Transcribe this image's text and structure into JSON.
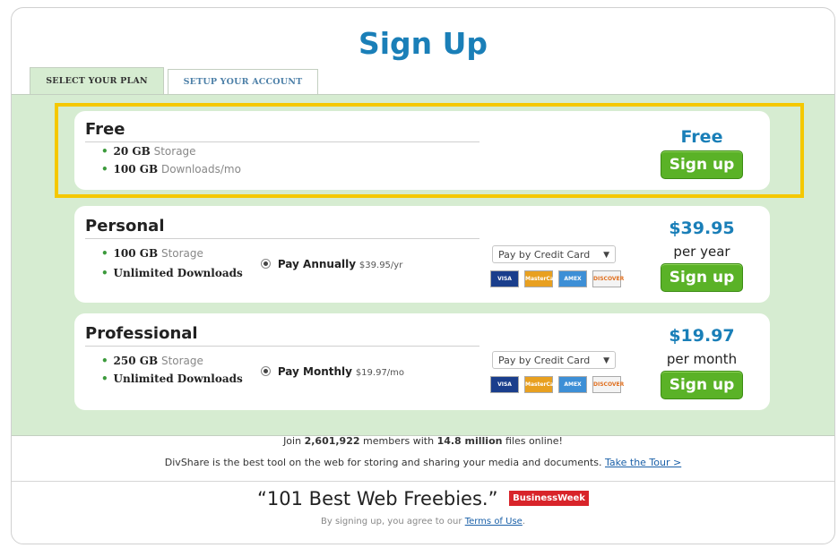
{
  "header": {
    "title": "Sign Up"
  },
  "tabs": [
    {
      "label": "SELECT YOUR PLAN",
      "active": true
    },
    {
      "label": "SETUP YOUR ACCOUNT",
      "active": false
    }
  ],
  "plans": {
    "free": {
      "name": "Free",
      "features": [
        {
          "bold": "20 GB",
          "light": "Storage"
        },
        {
          "bold": "100 GB",
          "light": "Downloads/mo"
        }
      ],
      "price": "Free",
      "button": "Sign up"
    },
    "personal": {
      "name": "Personal",
      "features": [
        {
          "bold": "100 GB",
          "light": "Storage"
        },
        {
          "bold": "Unlimited Downloads",
          "light": ""
        }
      ],
      "payment_option": {
        "label": "Pay Annually",
        "detail": "$39.95/yr"
      },
      "payment_select": "Pay by Credit Card",
      "price": "$39.95",
      "period": "per year",
      "button": "Sign up"
    },
    "professional": {
      "name": "Professional",
      "features": [
        {
          "bold": "250 GB",
          "light": "Storage"
        },
        {
          "bold": "Unlimited Downloads",
          "light": ""
        }
      ],
      "payment_option": {
        "label": "Pay Monthly",
        "detail": "$19.97/mo"
      },
      "payment_select": "Pay by Credit Card",
      "price": "$19.97",
      "period": "per month",
      "button": "Sign up"
    }
  },
  "cards": [
    "VISA",
    "MasterCard",
    "AMEX",
    "DISCOVER"
  ],
  "footer": {
    "join_pre": "Join",
    "members": "2,601,922",
    "join_mid": "members with",
    "files": "14.8 million",
    "join_post": "files online!",
    "desc": "DivShare is the best tool on the web for storing and sharing your media and documents.",
    "tour_link": "Take the Tour >",
    "quote": "“101 Best Web Freebies.”",
    "badge": "BusinessWeek",
    "terms_pre": "By signing up, you agree to our",
    "terms_link": "Terms of Use",
    "terms_post": "."
  },
  "colors": {
    "accent_blue": "#1a7fb8",
    "button_green": "#5ab227",
    "panel_green": "#d6ecd1",
    "highlight": "#f5c800"
  }
}
